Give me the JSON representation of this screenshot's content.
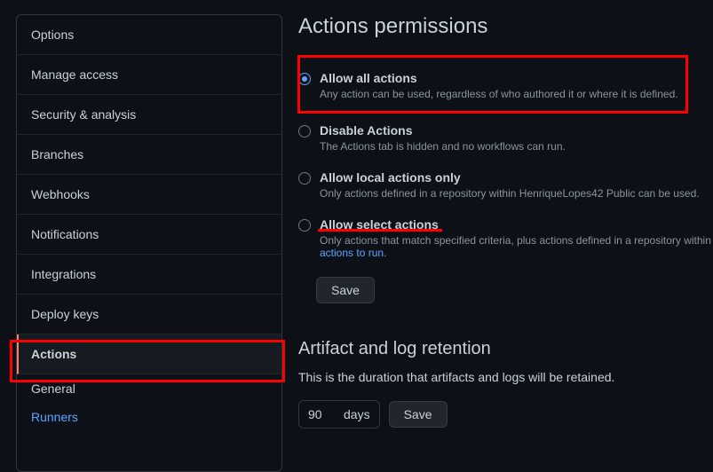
{
  "sidebar": {
    "items": [
      {
        "label": "Options"
      },
      {
        "label": "Manage access"
      },
      {
        "label": "Security & analysis"
      },
      {
        "label": "Branches"
      },
      {
        "label": "Webhooks"
      },
      {
        "label": "Notifications"
      },
      {
        "label": "Integrations"
      },
      {
        "label": "Deploy keys"
      },
      {
        "label": "Actions"
      }
    ],
    "subitems": [
      {
        "label": "General"
      },
      {
        "label": "Runners"
      }
    ]
  },
  "main": {
    "title": "Actions permissions",
    "options": [
      {
        "label": "Allow all actions",
        "desc": "Any action can be used, regardless of who authored it or where it is defined."
      },
      {
        "label": "Disable Actions",
        "desc": "The Actions tab is hidden and no workflows can run."
      },
      {
        "label": "Allow local actions only",
        "desc": "Only actions defined in a repository within HenriqueLopes42 Public can be used."
      },
      {
        "label": "Allow select actions",
        "desc_prefix": "Only actions that match specified criteria, plus actions defined in a repository within ",
        "link": "actions to run."
      }
    ],
    "save_label": "Save",
    "retention_title": "Artifact and log retention",
    "retention_desc": "This is the duration that artifacts and logs will be retained.",
    "retention_value": "90",
    "retention_unit": "days",
    "retention_save": "Save"
  }
}
